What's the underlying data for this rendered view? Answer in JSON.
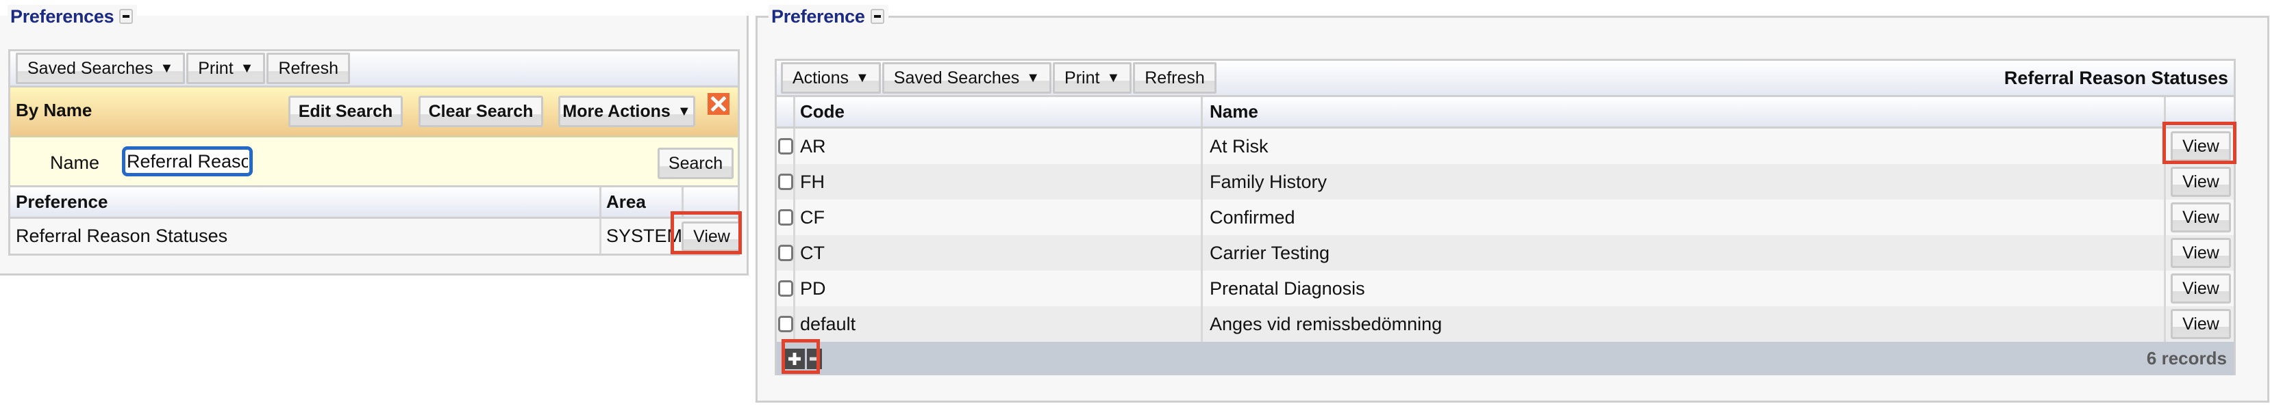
{
  "left_panel": {
    "legend": "Preferences",
    "toolbar": {
      "saved_searches": "Saved Searches",
      "print": "Print",
      "refresh": "Refresh"
    },
    "search_band": {
      "title": "By Name",
      "edit_search": "Edit Search",
      "clear_search": "Clear Search",
      "more_actions": "More Actions"
    },
    "name_field": {
      "label": "Name",
      "value": "Referral Reason Statuses"
    },
    "search_button": "Search",
    "table": {
      "columns": [
        "Preference",
        "Area",
        ""
      ],
      "rows": [
        {
          "preference": "Referral Reason Statuses",
          "area": "SYSTEM",
          "action": "View"
        }
      ]
    }
  },
  "right_panel": {
    "legend": "Preference",
    "toolbar": {
      "actions": "Actions",
      "saved_searches": "Saved Searches",
      "print": "Print",
      "refresh": "Refresh"
    },
    "caption": "Referral Reason Statuses",
    "table": {
      "columns": [
        "",
        "Code",
        "Name",
        ""
      ],
      "rows": [
        {
          "code": "AR",
          "name": "At Risk",
          "action": "View",
          "checked": false
        },
        {
          "code": "FH",
          "name": "Family History",
          "action": "View",
          "checked": false
        },
        {
          "code": "CF",
          "name": "Confirmed",
          "action": "View",
          "checked": false
        },
        {
          "code": "CT",
          "name": "Carrier Testing",
          "action": "View",
          "checked": false
        },
        {
          "code": "PD",
          "name": "Prenatal Diagnosis",
          "action": "View",
          "checked": false
        },
        {
          "code": "default",
          "name": "Anges vid remissbedömning",
          "action": "View",
          "checked": false
        }
      ]
    },
    "footer": {
      "record_count": "6 records"
    }
  },
  "icons": {
    "collapse": "minus-square-icon",
    "dropdown": "▼",
    "close": "close-x-icon",
    "add": "plus-icon",
    "remove": "minus-icon"
  },
  "colors": {
    "legend_text": "#1b2a82",
    "highlight": "#e2412b",
    "close_icon": "#ee6a35",
    "band_top": "#fff6bd",
    "band_bottom": "#efc98c",
    "footer_bg": "#c5ccd6"
  }
}
